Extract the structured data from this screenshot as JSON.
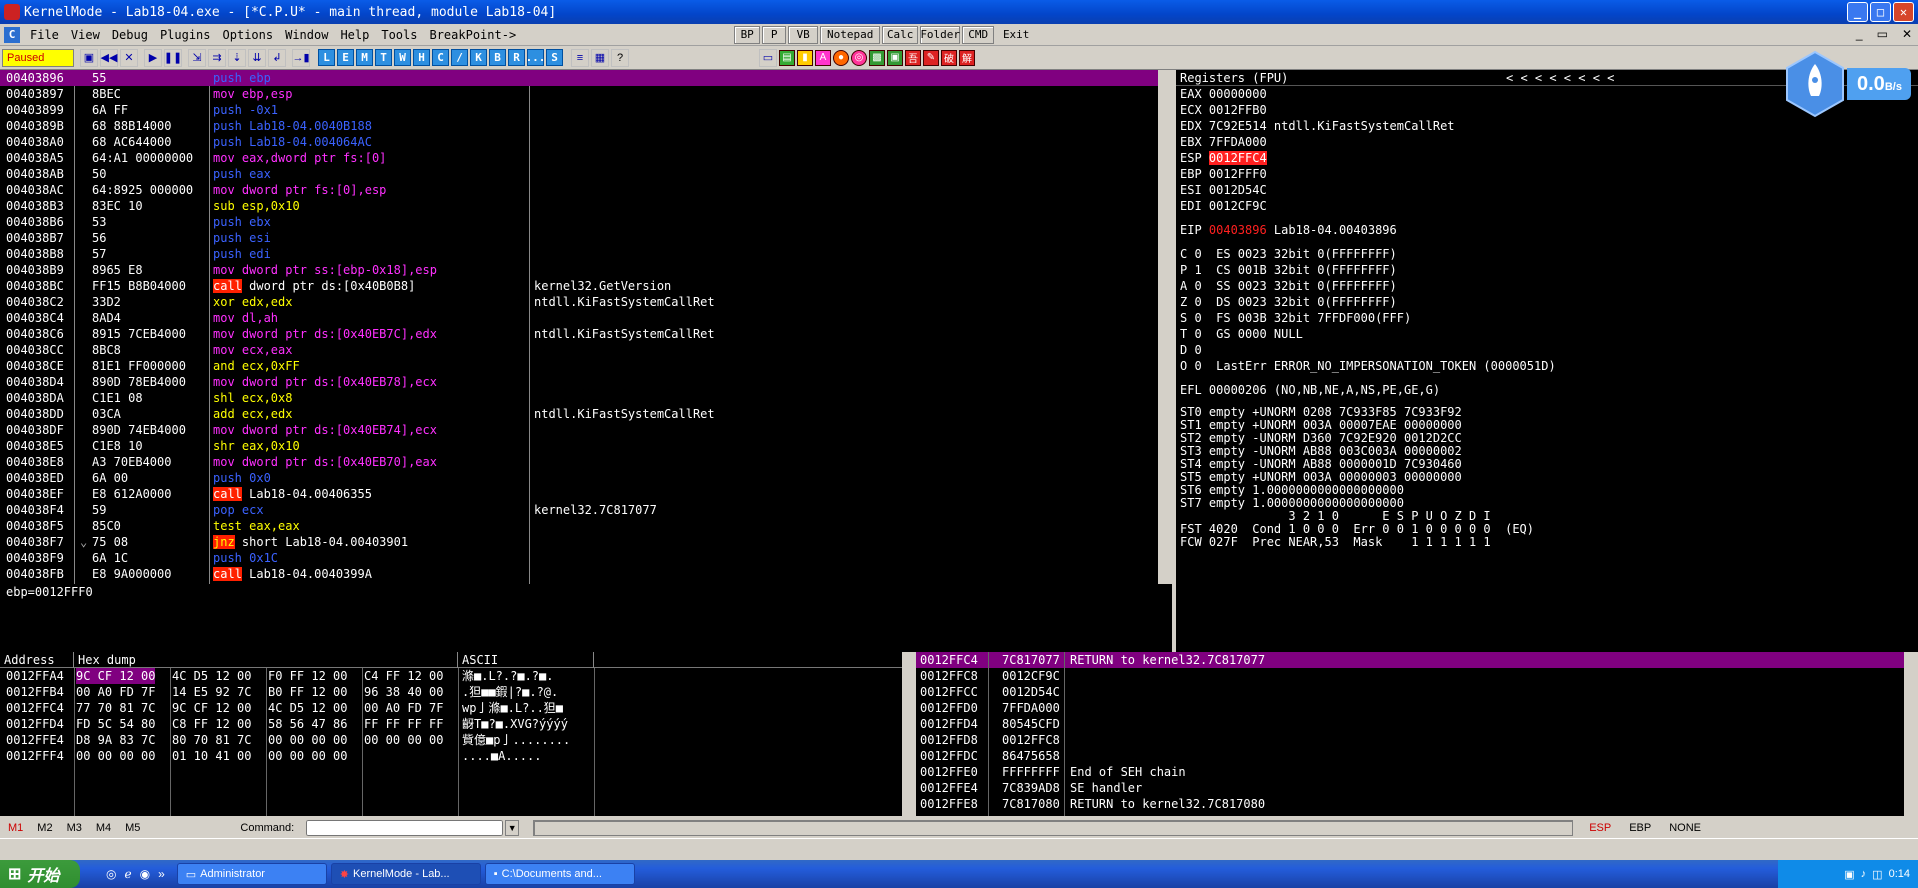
{
  "window": {
    "title": "KernelMode - Lab18-04.exe - [*C.P.U* - main thread, module Lab18-04]"
  },
  "menu": {
    "items": [
      "File",
      "View",
      "Debug",
      "Plugins",
      "Options",
      "Window",
      "Help",
      "Tools",
      "BreakPoint->"
    ],
    "plugins": [
      "BP",
      "P",
      "VB",
      "Notepad",
      "Calc",
      "Folder",
      "CMD",
      "Exit"
    ]
  },
  "toolbar": {
    "status": "Paused",
    "letters": [
      "L",
      "E",
      "M",
      "T",
      "W",
      "H",
      "C",
      "/",
      "K",
      "B",
      "R",
      "...",
      "S"
    ]
  },
  "asm": [
    {
      "addr": "00403896",
      "hex": "55",
      "op": "push ebp",
      "sel": true
    },
    {
      "addr": "00403897",
      "hex": "8BEC",
      "op": "mov ebp,esp"
    },
    {
      "addr": "00403899",
      "hex": "6A FF",
      "op": "push -0x1"
    },
    {
      "addr": "0040389B",
      "hex": "68 88B14000",
      "op": "push Lab18-04.0040B188"
    },
    {
      "addr": "004038A0",
      "hex": "68 AC644000",
      "op": "push Lab18-04.004064AC"
    },
    {
      "addr": "004038A5",
      "hex": "64:A1 00000000",
      "op": "mov eax,dword ptr fs:[0]"
    },
    {
      "addr": "004038AB",
      "hex": "50",
      "op": "push eax"
    },
    {
      "addr": "004038AC",
      "hex": "64:8925 000000",
      "op": "mov dword ptr fs:[0],esp"
    },
    {
      "addr": "004038B3",
      "hex": "83EC 10",
      "op": "sub esp,0x10"
    },
    {
      "addr": "004038B6",
      "hex": "53",
      "op": "push ebx"
    },
    {
      "addr": "004038B7",
      "hex": "56",
      "op": "push esi"
    },
    {
      "addr": "004038B8",
      "hex": "57",
      "op": "push edi"
    },
    {
      "addr": "004038B9",
      "hex": "8965 E8",
      "op": "mov dword ptr ss:[ebp-0x18],esp"
    },
    {
      "addr": "004038BC",
      "hex": "FF15 B8B04000",
      "op": "call dword ptr ds:[0x40B0B8]",
      "cmt": "kernel32.GetVersion"
    },
    {
      "addr": "004038C2",
      "hex": "33D2",
      "op": "xor edx,edx",
      "cmt": "ntdll.KiFastSystemCallRet"
    },
    {
      "addr": "004038C4",
      "hex": "8AD4",
      "op": "mov dl,ah"
    },
    {
      "addr": "004038C6",
      "hex": "8915 7CEB4000",
      "op": "mov dword ptr ds:[0x40EB7C],edx",
      "cmt": "ntdll.KiFastSystemCallRet"
    },
    {
      "addr": "004038CC",
      "hex": "8BC8",
      "op": "mov ecx,eax"
    },
    {
      "addr": "004038CE",
      "hex": "81E1 FF000000",
      "op": "and ecx,0xFF"
    },
    {
      "addr": "004038D4",
      "hex": "890D 78EB4000",
      "op": "mov dword ptr ds:[0x40EB78],ecx"
    },
    {
      "addr": "004038DA",
      "hex": "C1E1 08",
      "op": "shl ecx,0x8"
    },
    {
      "addr": "004038DD",
      "hex": "03CA",
      "op": "add ecx,edx",
      "cmt": "ntdll.KiFastSystemCallRet"
    },
    {
      "addr": "004038DF",
      "hex": "890D 74EB4000",
      "op": "mov dword ptr ds:[0x40EB74],ecx"
    },
    {
      "addr": "004038E5",
      "hex": "C1E8 10",
      "op": "shr eax,0x10"
    },
    {
      "addr": "004038E8",
      "hex": "A3 70EB4000",
      "op": "mov dword ptr ds:[0x40EB70],eax"
    },
    {
      "addr": "004038ED",
      "hex": "6A 00",
      "op": "push 0x0"
    },
    {
      "addr": "004038EF",
      "hex": "E8 612A0000",
      "op": "call Lab18-04.00406355"
    },
    {
      "addr": "004038F4",
      "hex": "59",
      "op": "pop ecx",
      "cmt": "kernel32.7C817077"
    },
    {
      "addr": "004038F5",
      "hex": "85C0",
      "op": "test eax,eax"
    },
    {
      "addr": "004038F7",
      "hex": "75 08",
      "op": "jnz short Lab18-04.00403901",
      "mark": "⌄"
    },
    {
      "addr": "004038F9",
      "hex": "6A 1C",
      "op": "push 0x1C"
    },
    {
      "addr": "004038FB",
      "hex": "E8 9A000000",
      "op": "call Lab18-04.0040399A"
    }
  ],
  "info": "ebp=0012FFF0",
  "registers": {
    "header": "Registers (FPU)",
    "nav": "<   <   <   <   <   <   <   <",
    "gp": [
      "EAX 00000000",
      "ECX 0012FFB0",
      "EDX 7C92E514 ntdll.KiFastSystemCallRet",
      "EBX 7FFDA000"
    ],
    "esp_label": "ESP ",
    "esp_value": "0012FFC4",
    "gp2": [
      "EBP 0012FFF0",
      "ESI 0012D54C",
      "EDI 0012CF9C"
    ],
    "eip_label": "EIP ",
    "eip_value": "00403896",
    "eip_cmt": " Lab18-04.00403896",
    "flags": [
      "C 0  ES 0023 32bit 0(FFFFFFFF)",
      "P 1  CS 001B 32bit 0(FFFFFFFF)",
      "A 0  SS 0023 32bit 0(FFFFFFFF)",
      "Z 0  DS 0023 32bit 0(FFFFFFFF)",
      "S 0  FS 003B 32bit 7FFDF000(FFF)",
      "T 0  GS 0000 NULL",
      "D 0",
      "O 0  LastErr ERROR_NO_IMPERSONATION_TOKEN (0000051D)"
    ],
    "efl": "EFL 00000206 (NO,NB,NE,A,NS,PE,GE,G)",
    "fpu": [
      "ST0 empty +UNORM 0208 7C933F85 7C933F92",
      "ST1 empty +UNORM 003A 00007EAE 00000000",
      "ST2 empty -UNORM D360 7C92E920 0012D2CC",
      "ST3 empty -UNORM AB88 003C003A 00000002",
      "ST4 empty -UNORM AB88 0000001D 7C930460",
      "ST5 empty +UNORM 003A 00000003 00000000",
      "ST6 empty 1.0000000000000000000",
      "ST7 empty 1.0000000000000000000",
      "               3 2 1 0      E S P U O Z D I",
      "FST 4020  Cond 1 0 0 0  Err 0 0 1 0 0 0 0 0  (EQ)",
      "FCW 027F  Prec NEAR,53  Mask    1 1 1 1 1 1"
    ]
  },
  "speed": {
    "value": "0.0",
    "unit": "B/s"
  },
  "dump": {
    "headers": [
      "Address",
      "Hex dump",
      "ASCII"
    ],
    "rows": [
      {
        "addr": "0012FFA4",
        "hex": [
          "9C CF 12 00",
          "4C D5 12 00",
          "F0 FF 12 00",
          "C4 FF 12 00"
        ],
        "ascii": "滌■.L?.?■.?■."
      },
      {
        "addr": "0012FFB4",
        "hex": [
          "00 A0 FD 7F",
          "14 E5 92 7C",
          "B0 FF 12 00",
          "96 38 40 00"
        ],
        "ascii": ".狚■■鍜|?■.?@."
      },
      {
        "addr": "0012FFC4",
        "hex": [
          "77 70 81 7C",
          "9C CF 12 00",
          "4C D5 12 00",
          "00 A0 FD 7F"
        ],
        "ascii": "wp亅滌■.L?..狚■"
      },
      {
        "addr": "0012FFD4",
        "hex": [
          "FD 5C 54 80",
          "C8 FF 12 00",
          "58 56 47 86",
          "FF FF FF FF"
        ],
        "ascii": "齖T■?■.XVG?ýýýý"
      },
      {
        "addr": "0012FFE4",
        "hex": [
          "D8 9A 83 7C",
          "80 70 81 7C",
          "00 00 00 00",
          "00 00 00 00"
        ],
        "ascii": "貲億■p亅........"
      },
      {
        "addr": "0012FFF4",
        "hex": [
          "00 00 00 00",
          "01 10 41 00",
          "00 00 00 00",
          ""
        ],
        "ascii": "....■A....."
      }
    ]
  },
  "stack": [
    {
      "addr": "0012FFC4",
      "val": "7C817077",
      "cmt": "RETURN to kernel32.7C817077",
      "sel": true
    },
    {
      "addr": "0012FFC8",
      "val": "0012CF9C",
      "cmt": ""
    },
    {
      "addr": "0012FFCC",
      "val": "0012D54C",
      "cmt": ""
    },
    {
      "addr": "0012FFD0",
      "val": "7FFDA000",
      "cmt": ""
    },
    {
      "addr": "0012FFD4",
      "val": "80545CFD",
      "cmt": ""
    },
    {
      "addr": "0012FFD8",
      "val": "0012FFC8",
      "cmt": ""
    },
    {
      "addr": "0012FFDC",
      "val": "86475658",
      "cmt": ""
    },
    {
      "addr": "0012FFE0",
      "val": "FFFFFFFF",
      "cmt": "End of SEH chain"
    },
    {
      "addr": "0012FFE4",
      "val": "7C839AD8",
      "cmt": "SE handler"
    },
    {
      "addr": "0012FFE8",
      "val": "7C817080",
      "cmt": "RETURN to kernel32.7C817080"
    }
  ],
  "tabs": {
    "items": [
      "M1",
      "M2",
      "M3",
      "M4",
      "M5"
    ],
    "command_label": "Command:",
    "right": [
      "ESP",
      "EBP",
      "NONE"
    ]
  },
  "taskbar": {
    "start": "开始",
    "tasks": [
      "Administrator",
      "KernelMode - Lab...",
      "C:\\Documents and..."
    ],
    "time": "0:14"
  },
  "colors": {
    "accent": "#0345c9",
    "selection": "#800080",
    "call": "#ff2000"
  }
}
